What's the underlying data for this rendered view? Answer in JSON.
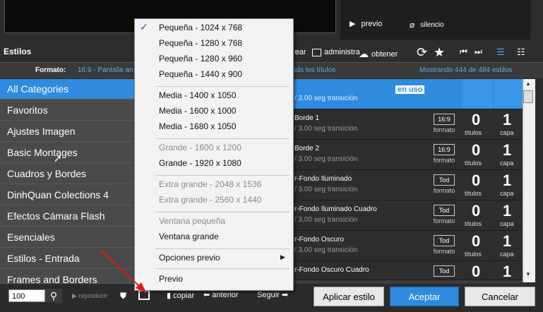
{
  "preview": {
    "play_label": "previo",
    "mute_label": "silencio"
  },
  "toolbar": {
    "title": "Estilos",
    "crear": "rear",
    "administra": "administra",
    "obtener": "obtener"
  },
  "format_row": {
    "label": "Formato:",
    "value": "16:9 - Pantalla an",
    "filter_tail": "ods los títulos",
    "count": "Mostrando 444 de 484 estilos"
  },
  "categories": [
    "All Categories",
    "Favoritos",
    "Ajustes Imagen",
    "Basic Montages",
    "Cuadros y Bordes",
    "DinhQuan Colections 4",
    "Efectos Cámara Flash",
    "Esenciales",
    "Estilos - Entrada",
    "Frames and Borders"
  ],
  "styles": [
    {
      "name": "",
      "sub": "/ 3.00 seg transición",
      "badge": "en uso"
    },
    {
      "name": "Borde 1",
      "sub": "/ 3.00 seg transición",
      "badge": "16:9",
      "fmt": "formato",
      "titles": "0",
      "tl": "títulos",
      "layers": "1",
      "ll": "capa"
    },
    {
      "name": "Borde 2",
      "sub": "/ 3.00 seg transición",
      "badge": "16:9",
      "fmt": "formato",
      "titles": "0",
      "tl": "títulos",
      "layers": "1",
      "ll": "capa"
    },
    {
      "name": "r-Fondo Iluminado",
      "sub": "/ 3.00 seg transición",
      "badge": "Tod",
      "fmt": "formato",
      "titles": "0",
      "tl": "títulos",
      "layers": "1",
      "ll": "capa"
    },
    {
      "name": "r-Fondo Iluminado Cuadro",
      "sub": "/ 3.00 seg transición",
      "badge": "Tod",
      "fmt": "formato",
      "titles": "0",
      "tl": "títulos",
      "layers": "1",
      "ll": "capa"
    },
    {
      "name": "r-Fondo Oscuro",
      "sub": "/ 3.00 seg transición",
      "badge": "Tod",
      "fmt": "formato",
      "titles": "0",
      "tl": "títulos",
      "layers": "1",
      "ll": "capa"
    },
    {
      "name": "r-Fondo Oscuro Cuadro",
      "sub": "",
      "badge": "Tod",
      "fmt": "",
      "titles": "0",
      "tl": "",
      "layers": "1",
      "ll": ""
    }
  ],
  "menu": {
    "items": [
      {
        "label": "Pequeña - 1024 x 768",
        "checked": true
      },
      {
        "label": "Pequeña - 1280 x 768"
      },
      {
        "label": "Pequeña - 1280 x 960"
      },
      {
        "label": "Pequeña - 1440 x 900"
      },
      {
        "label": "Media - 1400 x 1050"
      },
      {
        "label": "Media - 1600 x 1000"
      },
      {
        "label": "Media - 1680 x 1050"
      },
      {
        "label": "Grande - 1600 x 1200",
        "disabled": true
      },
      {
        "label": "Grande - 1920 x 1080"
      },
      {
        "label": "Extra grande - 2048 x 1536",
        "disabled": true
      },
      {
        "label": "Extra grande - 2560 x 1440",
        "disabled": true
      },
      {
        "label": "Ventana pequeña",
        "disabled": true
      },
      {
        "label": "Ventana grande"
      },
      {
        "label": "Opciones previo"
      },
      {
        "label": "Previo"
      }
    ]
  },
  "bottom": {
    "zoom": "100",
    "reproducir": "reproducir",
    "copiar": "copiar",
    "anterior": "anterior",
    "seguir": "Seguir",
    "aplicar": "Aplicar estilo",
    "aceptar": "Aceptar",
    "cancelar": "Cancelar"
  }
}
